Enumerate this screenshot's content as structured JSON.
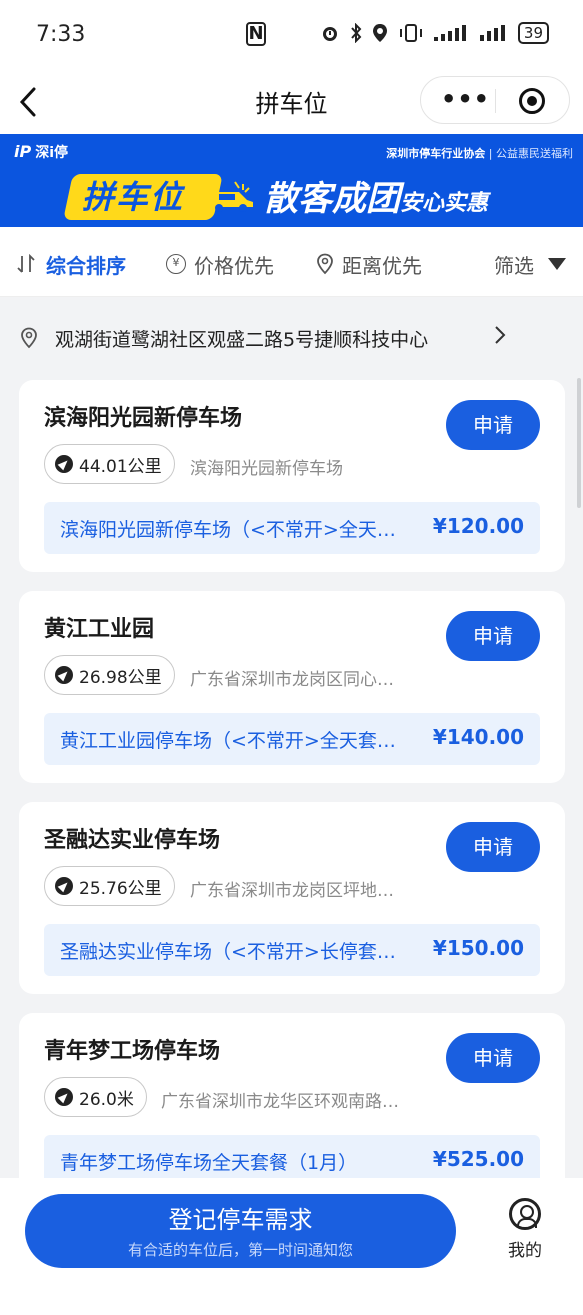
{
  "status_bar": {
    "time": "7:33",
    "nfc": "N",
    "icons": [
      "alarm-icon",
      "bluetooth-icon",
      "location-icon",
      "vibrate-icon",
      "wifi-icon",
      "signal-icon"
    ],
    "battery": "39"
  },
  "nav": {
    "title": "拼车位",
    "more": "•••"
  },
  "banner": {
    "brand": "深i停",
    "logo": "iP",
    "association": "深圳市停车行业协会",
    "association_sub": "公益惠民送福利",
    "badge": "拼车位",
    "slogan_big": "散客成团",
    "slogan_small": "安心实惠",
    "colors": {
      "background": "#0b55df",
      "badge": "#ffd91a"
    }
  },
  "sort": {
    "items": [
      {
        "label": "综合排序",
        "icon": "sort-icon",
        "active": true
      },
      {
        "label": "价格优先",
        "icon": "yuan-icon",
        "active": false
      },
      {
        "label": "距离优先",
        "icon": "location-pin-icon",
        "active": false
      }
    ],
    "filter_label": "筛选"
  },
  "location": {
    "address": "观湖街道鹭湖社区观盛二路5号捷顺科技中心"
  },
  "lots": [
    {
      "name": "滨海阳光园新停车场",
      "apply": "申请",
      "distance": "44.01公里",
      "address": "滨海阳光园新停车场",
      "package": "滨海阳光园新停车场（<不常开>全天…",
      "price": "¥120.00"
    },
    {
      "name": "黄江工业园",
      "apply": "申请",
      "distance": "26.98公里",
      "address": "广东省深圳市龙岗区同心…",
      "package": "黄江工业园停车场（<不常开>全天套…",
      "price": "¥140.00"
    },
    {
      "name": "圣融达实业停车场",
      "apply": "申请",
      "distance": "25.76公里",
      "address": "广东省深圳市龙岗区坪地…",
      "package": "圣融达实业停车场（<不常开>长停套…",
      "price": "¥150.00"
    },
    {
      "name": "青年梦工场停车场",
      "apply": "申请",
      "distance": "26.0米",
      "address": "广东省深圳市龙华区环观南路…",
      "package": "青年梦工场停车场全天套餐（1月）",
      "price": "¥525.00"
    }
  ],
  "bottom": {
    "cta_main": "登记停车需求",
    "cta_sub": "有合适的车位后，第一时间通知您",
    "mine_label": "我的"
  },
  "colors": {
    "accent": "#1a5fe0",
    "page_bg": "#f2f3f5"
  }
}
